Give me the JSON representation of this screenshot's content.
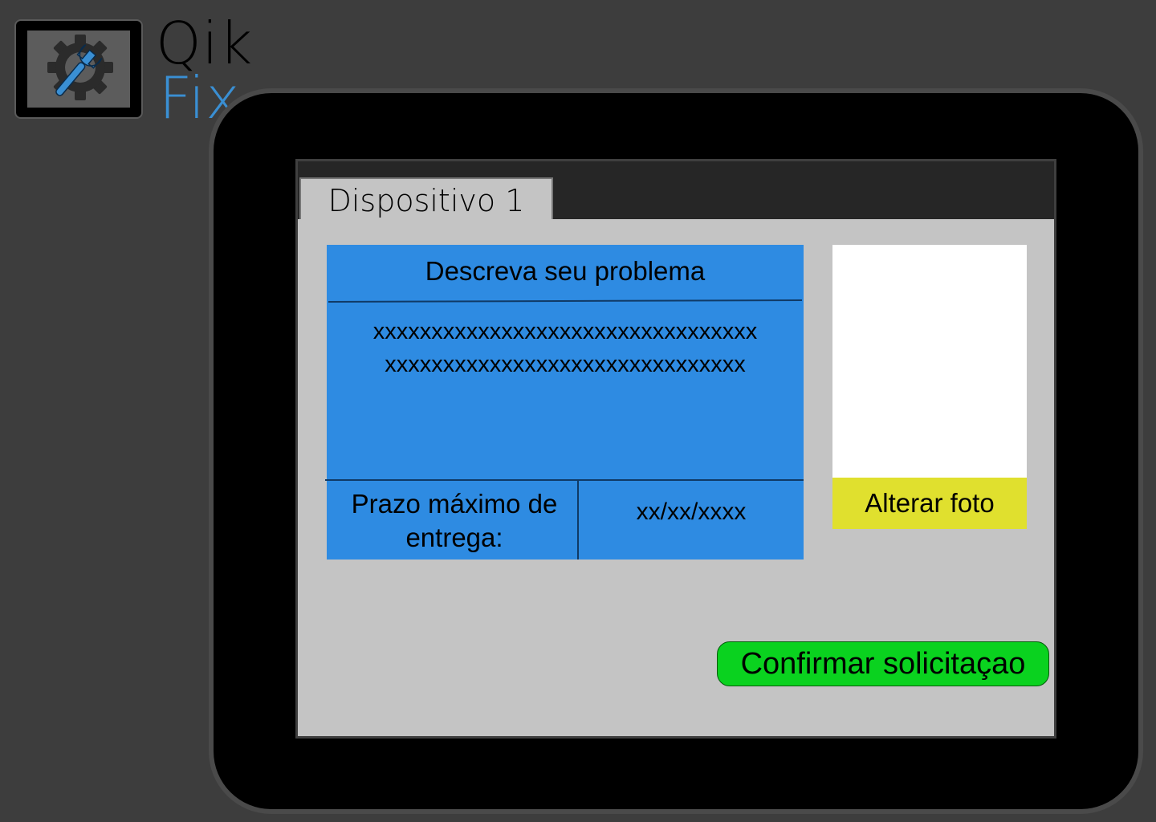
{
  "app": {
    "logo_text_top": "Qik",
    "logo_text_bottom": "Fix",
    "logo_icon": "gear-wrench-icon"
  },
  "tab": {
    "label": "Dispositivo 1"
  },
  "problem": {
    "title": "Descreva seu problema",
    "description_line1": "xxxxxxxxxxxxxxxxxxxxxxxxxxxxxxxxx",
    "description_line2": "xxxxxxxxxxxxxxxxxxxxxxxxxxxxxxx"
  },
  "deadline": {
    "label_line1": "Prazo máximo de",
    "label_line2": "entrega:",
    "value": "xx/xx/xxxx"
  },
  "photo": {
    "button_label": "Alterar foto"
  },
  "confirm": {
    "button_label": "Confirmar solicitaçao"
  },
  "colors": {
    "background": "#3d3d3d",
    "tablet_frame": "#000000",
    "screen_content": "#c4c4c4",
    "card_blue": "#2e8be2",
    "photo_button_yellow": "#e0e02e",
    "confirm_green": "#0ad21f",
    "logo_accent": "#3a8fd3"
  }
}
